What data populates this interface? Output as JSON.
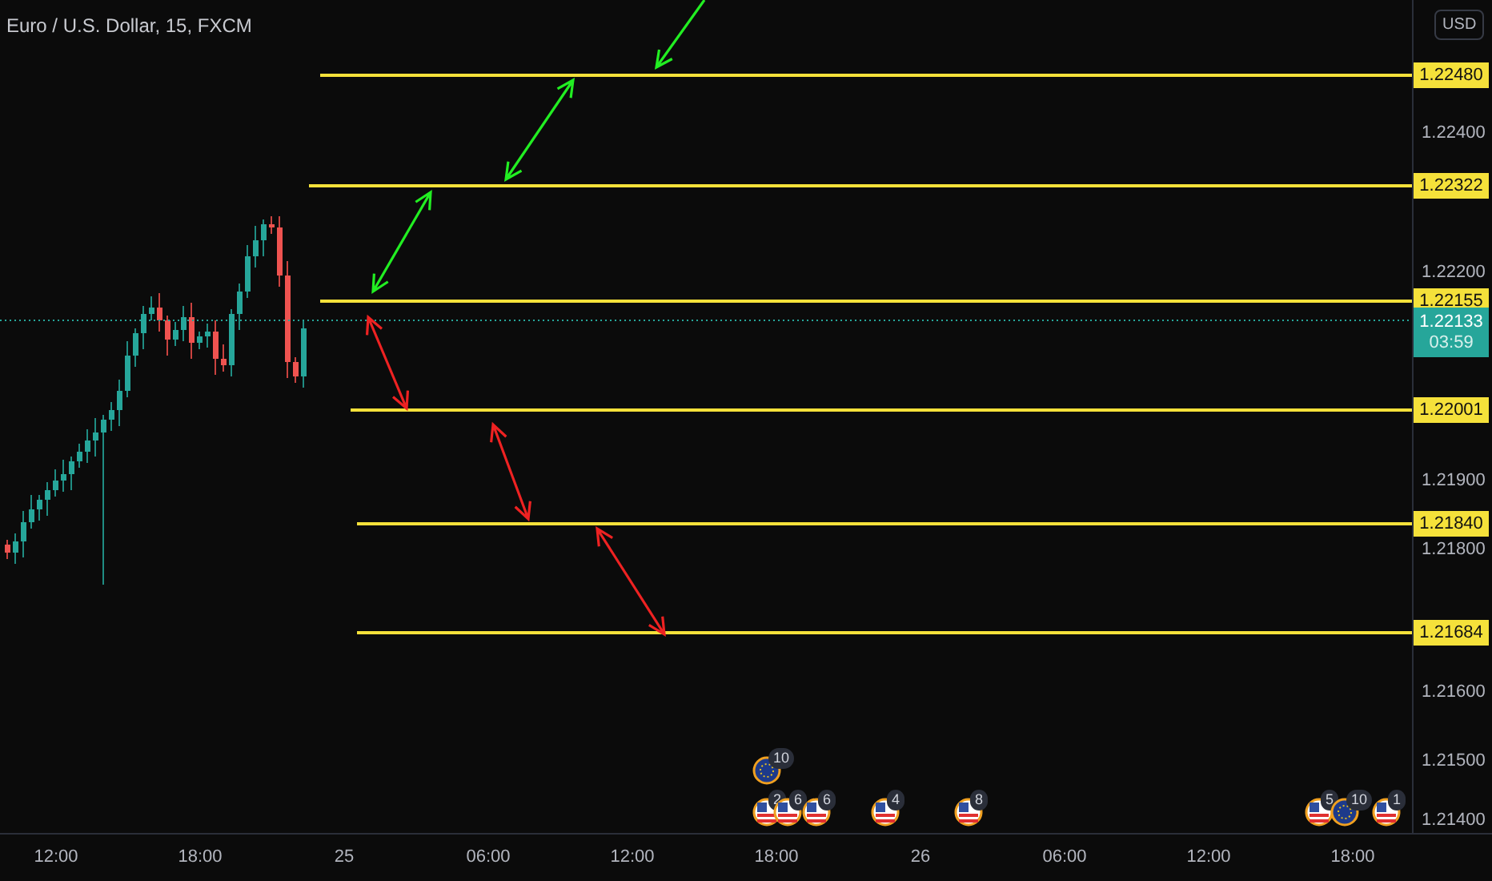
{
  "chart": {
    "title": "Euro / U.S. Dollar, 15, FXCM",
    "levels": [
      {
        "price": "1.22480"
      },
      {
        "price": "1.22322"
      },
      {
        "price": "1.22155"
      },
      {
        "price": "1.22001"
      },
      {
        "price": "1.21840"
      },
      {
        "price": "1.21684"
      }
    ],
    "arrows": [
      {
        "color": "#22ee22",
        "kind": "single"
      },
      {
        "color": "#22ee22",
        "kind": "double"
      },
      {
        "color": "#22ee22",
        "kind": "double"
      },
      {
        "color": "#ee2222",
        "kind": "double"
      },
      {
        "color": "#ee2222",
        "kind": "double"
      },
      {
        "color": "#ee2222",
        "kind": "double"
      }
    ],
    "events": [
      {
        "kind": "eu",
        "count": "10"
      },
      {
        "kind": "us",
        "count": "2"
      },
      {
        "kind": "us",
        "count": "6"
      },
      {
        "kind": "us",
        "count": "6"
      },
      {
        "kind": "us",
        "count": "4"
      },
      {
        "kind": "us",
        "count": "8"
      },
      {
        "kind": "us",
        "count": "5"
      },
      {
        "kind": "eu",
        "count": "10"
      },
      {
        "kind": "us",
        "count": "1"
      }
    ]
  },
  "price_axis": {
    "currency": "USD",
    "ticks": [
      "1.22400",
      "1.22200",
      "1.21900",
      "1.21800",
      "1.21600",
      "1.21500",
      "1.21400"
    ],
    "current_price": "1.22133",
    "countdown": "03:59"
  },
  "time_axis": {
    "ticks": [
      "12:00",
      "18:00",
      "25",
      "06:00",
      "12:00",
      "18:00",
      "26",
      "06:00",
      "12:00",
      "18:00"
    ]
  }
}
